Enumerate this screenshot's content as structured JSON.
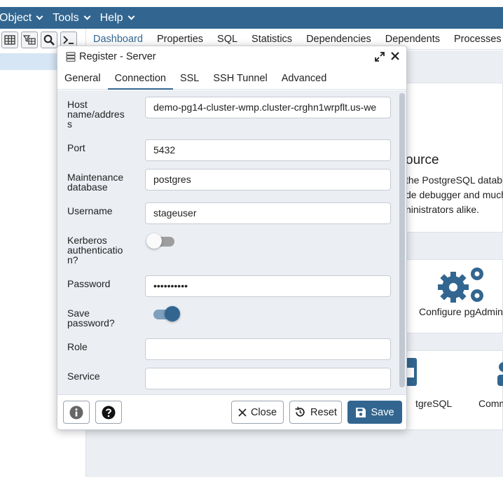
{
  "menubar": {
    "items": [
      "Object",
      "Tools",
      "Help"
    ]
  },
  "main_tabs": [
    "Dashboard",
    "Properties",
    "SQL",
    "Statistics",
    "Dependencies",
    "Dependents",
    "Processes"
  ],
  "background": {
    "heading_fragment": "ource",
    "text_lines": [
      "the PostgreSQL datab",
      "de debugger and much",
      "ninistrators alike."
    ],
    "configure_label": "Configure pgAdmin",
    "postgresql_label": "tgreSQL",
    "community_label": "Comm"
  },
  "dialog": {
    "title": "Register - Server",
    "tabs": [
      "General",
      "Connection",
      "SSL",
      "SSH Tunnel",
      "Advanced"
    ],
    "active_tab": "Connection",
    "fields": {
      "host": {
        "label": "Host name/address",
        "value": "demo-pg14-cluster-wmp.cluster-crghn1wrpflt.us-we"
      },
      "port": {
        "label": "Port",
        "value": "5432"
      },
      "maintenance_db": {
        "label": "Maintenance database",
        "value": "postgres"
      },
      "username": {
        "label": "Username",
        "value": "stageuser"
      },
      "kerberos": {
        "label": "Kerberos authentication?",
        "enabled": false
      },
      "password": {
        "label": "Password",
        "value": "••••••••••"
      },
      "save_password": {
        "label": "Save password?",
        "enabled": true
      },
      "role": {
        "label": "Role",
        "value": ""
      },
      "service": {
        "label": "Service",
        "value": ""
      }
    },
    "footer": {
      "info_icon": "info-icon",
      "help_icon": "help-icon",
      "close_label": "Close",
      "reset_label": "Reset",
      "save_label": "Save"
    }
  },
  "colors": {
    "brand": "#326690",
    "body_bg": "#ebeef3"
  }
}
